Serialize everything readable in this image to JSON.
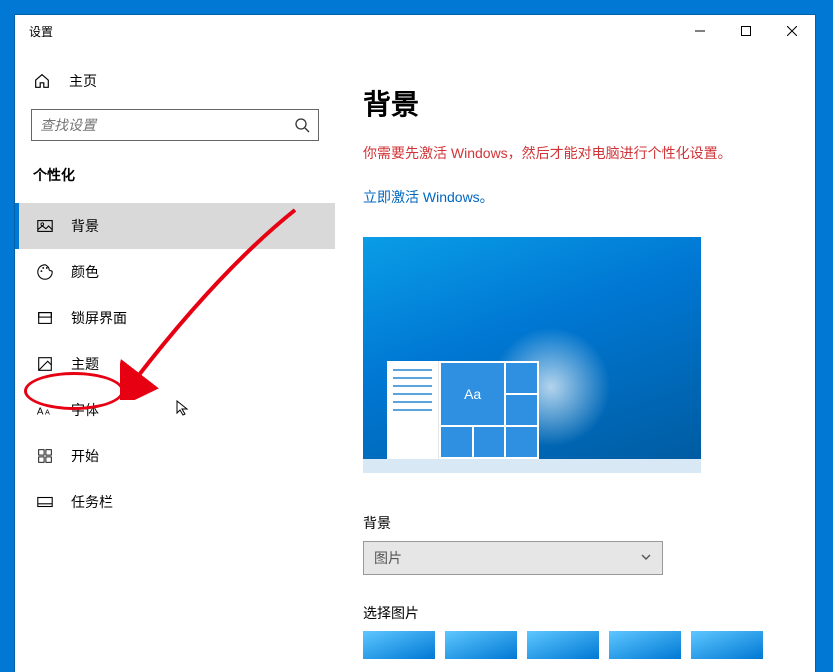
{
  "titlebar": {
    "title": "设置"
  },
  "sidebar": {
    "home_label": "主页",
    "search_placeholder": "查找设置",
    "category_label": "个性化",
    "items": [
      {
        "label": "背景"
      },
      {
        "label": "颜色"
      },
      {
        "label": "锁屏界面"
      },
      {
        "label": "主题"
      },
      {
        "label": "字体"
      },
      {
        "label": "开始"
      },
      {
        "label": "任务栏"
      }
    ]
  },
  "content": {
    "page_title": "背景",
    "activation_warning": "你需要先激活 Windows，然后才能对电脑进行个性化设置。",
    "activation_link": "立即激活 Windows。",
    "preview_tile_text": "Aa",
    "background_section_label": "背景",
    "background_dropdown_value": "图片",
    "choose_picture_label": "选择图片"
  },
  "colors": {
    "accent": "#0078d4",
    "warning": "#d13438",
    "link": "#0067c0"
  }
}
